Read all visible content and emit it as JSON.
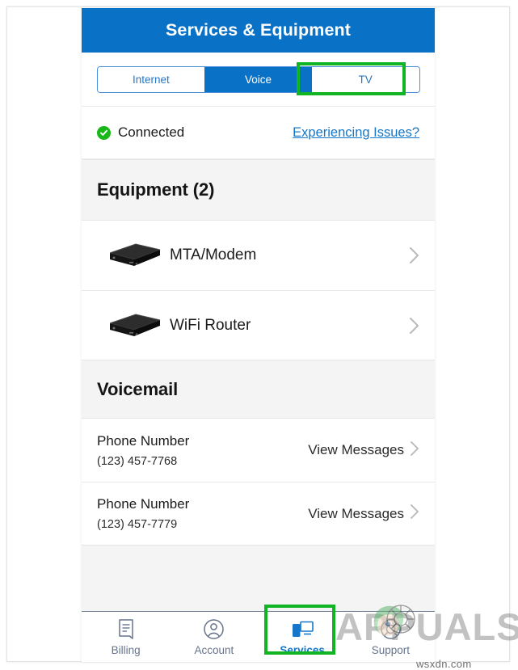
{
  "app": {
    "header_title": "Services & Equipment"
  },
  "tabs": {
    "items": [
      {
        "label": "Internet",
        "state": "inactive"
      },
      {
        "label": "Voice",
        "state": "active"
      },
      {
        "label": "TV",
        "state": "inactive"
      }
    ],
    "highlighted": "TV",
    "highlight_color": "#11b422"
  },
  "status": {
    "icon": "check-circle-icon",
    "label": "Connected",
    "link_label": "Experiencing Issues?",
    "status_color": "#18b818",
    "link_color": "#1577c9"
  },
  "equipment": {
    "section_title": "Equipment (2)",
    "items": [
      {
        "name": "MTA/Modem",
        "icon": "modem-device-icon"
      },
      {
        "name": "WiFi Router",
        "icon": "router-device-icon"
      }
    ]
  },
  "voicemail": {
    "section_title": "Voicemail",
    "items": [
      {
        "label": "Phone Number",
        "number": "(123) 457-7768",
        "action": "View Messages"
      },
      {
        "label": "Phone Number",
        "number": "(123) 457-7779",
        "action": "View Messages"
      }
    ]
  },
  "bottom_nav": {
    "items": [
      {
        "label": "Billing",
        "icon": "bill-document-icon",
        "state": "inactive"
      },
      {
        "label": "Account",
        "icon": "person-circle-icon",
        "state": "inactive"
      },
      {
        "label": "Services",
        "icon": "phone-monitor-icon",
        "state": "active"
      },
      {
        "label": "Support",
        "icon": "lifebuoy-icon",
        "state": "inactive"
      }
    ],
    "highlighted": "Services",
    "active_color": "#1577c9",
    "inactive_color": "#66748c"
  },
  "watermark": {
    "brand": "APPUALS",
    "domain": "wsxdn.com"
  },
  "theme": {
    "header_blue": "#0a72c6",
    "section_gray": "#f4f4f4"
  }
}
